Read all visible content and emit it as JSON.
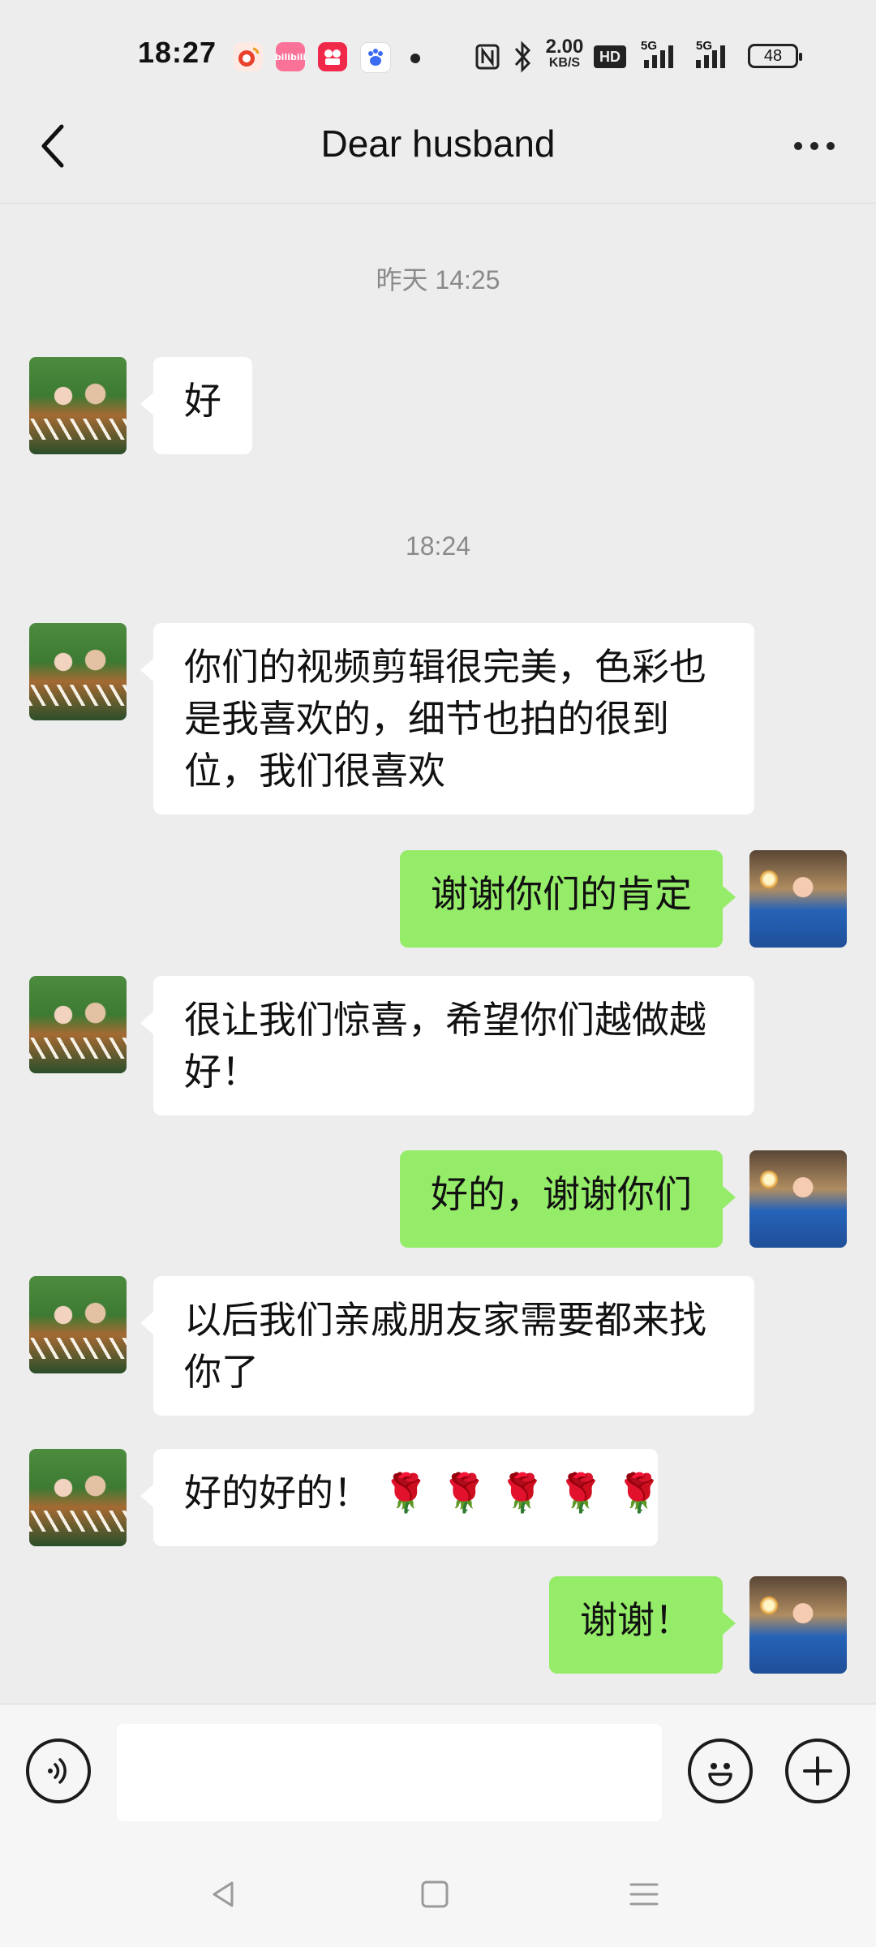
{
  "status_bar": {
    "time": "18:27",
    "app_icons": [
      {
        "name": "weibo-icon",
        "color": "#e8412c"
      },
      {
        "name": "bilibili-icon",
        "color": "#fb7299",
        "label": "bilibili"
      },
      {
        "name": "douyin-video-icon",
        "color": "#f0284a"
      },
      {
        "name": "baidu-icon",
        "color": "#3c6cf3"
      }
    ],
    "network_speed": "2.00",
    "network_speed_unit": "KB/S",
    "hd_label": "HD",
    "signal_1": "5G",
    "signal_2": "5G",
    "battery": "48"
  },
  "header": {
    "title": "Dear husband"
  },
  "timestamps": {
    "first": "昨天 14:25",
    "second": "18:24"
  },
  "messages": [
    {
      "side": "other",
      "text": "好"
    },
    {
      "side": "other",
      "text": "你们的视频剪辑很完美，色彩也是我喜欢的，细节也拍的很到位，我们很喜欢"
    },
    {
      "side": "me",
      "text": "谢谢你们的肯定"
    },
    {
      "side": "other",
      "text": "很让我们惊喜，希望你们越做越好！"
    },
    {
      "side": "me",
      "text": "好的，谢谢你们"
    },
    {
      "side": "other",
      "text": "以后我们亲戚朋友家需要都来找你了"
    },
    {
      "side": "other",
      "text": "好的好的！ 🌹 🌹 🌹 🌹 🌹"
    },
    {
      "side": "me",
      "text": "谢谢！"
    }
  ],
  "input_bar": {
    "placeholder": "",
    "value": ""
  },
  "colors": {
    "background": "#ededed",
    "my_bubble": "#95ec69",
    "other_bubble": "#ffffff"
  }
}
